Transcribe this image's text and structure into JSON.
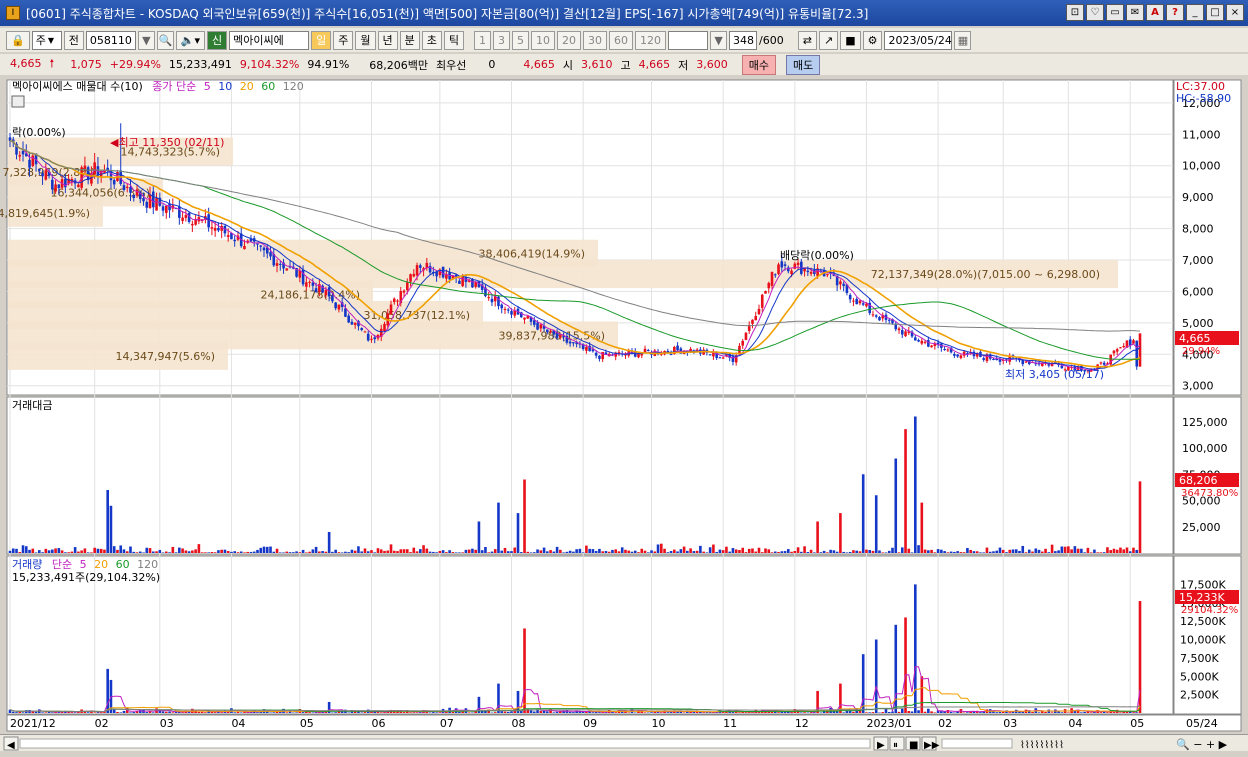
{
  "window": {
    "title": "[0601] 주식종합차트 - KOSDAQ 외국인보유[659(천)] 주식수[16,051(천)] 액면[500] 자본금[80(억)] 결산[12월] EPS[-167] 시가총액[749(억)] 유통비율[72.3]",
    "app_icon_label": "I",
    "controls": [
      "⊡",
      "♡",
      "▭",
      "✉",
      "A",
      "?",
      "_",
      "□",
      "×"
    ]
  },
  "toolbar": {
    "lock_icon": "🔒",
    "market_select": "주",
    "prev_label": "전",
    "code_input": "058110",
    "company_button": "멕아이씨에",
    "period_tabs": [
      "일",
      "주",
      "월",
      "년",
      "분",
      "초",
      "틱"
    ],
    "active_period": "일",
    "interval_buttons": [
      "1",
      "3",
      "5",
      "10",
      "20",
      "30",
      "60",
      "120"
    ],
    "count_value": "348",
    "count_total": "/600",
    "date_value": "2023/05/24",
    "new_label": "신"
  },
  "quote": {
    "price": "4,665",
    "change": "1,075",
    "change_pct": "+29.94%",
    "volume": "15,233,491",
    "volume_ratio": "9,104.32%",
    "strength": "94.91%",
    "amount": "68,206백만",
    "priority_label": "최우선",
    "priority_value": "0",
    "bid": "4,665",
    "open_label": "시",
    "open": "3,610",
    "high_label": "고",
    "high": "4,665",
    "low_label": "저",
    "low": "3,600",
    "buy_label": "매수",
    "sell_label": "매도"
  },
  "panels": {
    "price": {
      "legend_name": "멕아이씨에스 매물대 수(10)",
      "ma_label": "종가 단순",
      "ma_periods": [
        "5",
        "10",
        "20",
        "60",
        "120"
      ],
      "lc_label": "LC:37.00",
      "hc_label": "HC:-58.90",
      "current_price_tag": "4,665",
      "current_change_tag": "29.94%",
      "y_ticks": [
        "12,000",
        "11,000",
        "10,000",
        "9,000",
        "8,000",
        "7,000",
        "6,000",
        "5,000",
        "4,000",
        "3,000"
      ],
      "annotations": {
        "high": "최고 11,350 (02/11)",
        "low": "최저 3,405 (05/17)",
        "dividend": "배당락(0.00%)",
        "start": "락(0.00%)"
      },
      "volume_profile": [
        {
          "label": "14,743,323(5.7%)",
          "price": 10450
        },
        {
          "label": "7,328,969(2.8%)",
          "price": 9800
        },
        {
          "label": "16,344,056(6.3%)",
          "price": 9150
        },
        {
          "label": "4,819,645(1.9%)",
          "price": 8500
        },
        {
          "label": "38,406,419(14.9%)",
          "price": 7200
        },
        {
          "label": "72,137,349(28.0%)(7,015.00 ~ 6,298.00)",
          "price": 6550
        },
        {
          "label": "24,186,178(9.4%)",
          "price": 5900
        },
        {
          "label": "31,058,737(12.1%)",
          "price": 5250
        },
        {
          "label": "39,837,988(15.5%)",
          "price": 4600
        },
        {
          "label": "14,347,947(5.6%)",
          "price": 3950
        }
      ]
    },
    "amount": {
      "legend_name": "거래대금",
      "y_ticks": [
        "125,000",
        "100,000",
        "75,000",
        "50,000",
        "25,000"
      ],
      "current_tag": "68,206",
      "ratio_tag": "36473.80%"
    },
    "volume": {
      "legend_name": "거래량",
      "ma_label": "단순",
      "ma_periods": [
        "5",
        "20",
        "60",
        "120"
      ],
      "value_label": "15,233,491주(29,104.32%)",
      "y_ticks": [
        "17,500K",
        "15,000K",
        "12,500K",
        "10,000K",
        "7,500K",
        "5,000K",
        "2,500K"
      ],
      "current_tag": "15,233K",
      "ratio_tag": "29104.32%"
    }
  },
  "x_axis": {
    "labels": [
      "2021/12",
      "02",
      "03",
      "04",
      "05",
      "06",
      "07",
      "08",
      "09",
      "10",
      "11",
      "12",
      "2023/01",
      "02",
      "03",
      "04",
      "05"
    ],
    "right_label": "05/24"
  },
  "colors": {
    "up": "#e8101a",
    "down": "#1437c8",
    "ma5": "#c020c0",
    "ma10": "#1437c8",
    "ma20": "#f0a000",
    "ma60": "#1a9a2a",
    "ma120": "#808080",
    "profile": "#f5e4cf"
  },
  "chart_data": {
    "type": "candlestick",
    "x_labels": [
      "2021/12",
      "02",
      "03",
      "04",
      "05",
      "06",
      "07",
      "08",
      "09",
      "10",
      "11",
      "12",
      "2023/01",
      "02",
      "03",
      "04",
      "05"
    ],
    "close_anchors": [
      10800,
      9400,
      9900,
      8900,
      8400,
      7700,
      6900,
      5900,
      4400,
      6900,
      6400,
      5500,
      4600,
      3950,
      4050,
      4150,
      3850,
      6900,
      6600,
      5400,
      4500,
      4000,
      3850,
      3700,
      3500,
      4665
    ],
    "price_ylim": [
      2800,
      12600
    ],
    "amount_ylim": [
      0,
      140000
    ],
    "volume_ylim": [
      0,
      20000
    ],
    "last": {
      "open": 3610,
      "high": 4665,
      "low": 3600,
      "close": 4665,
      "amount": 68206,
      "volume": 15233
    }
  }
}
